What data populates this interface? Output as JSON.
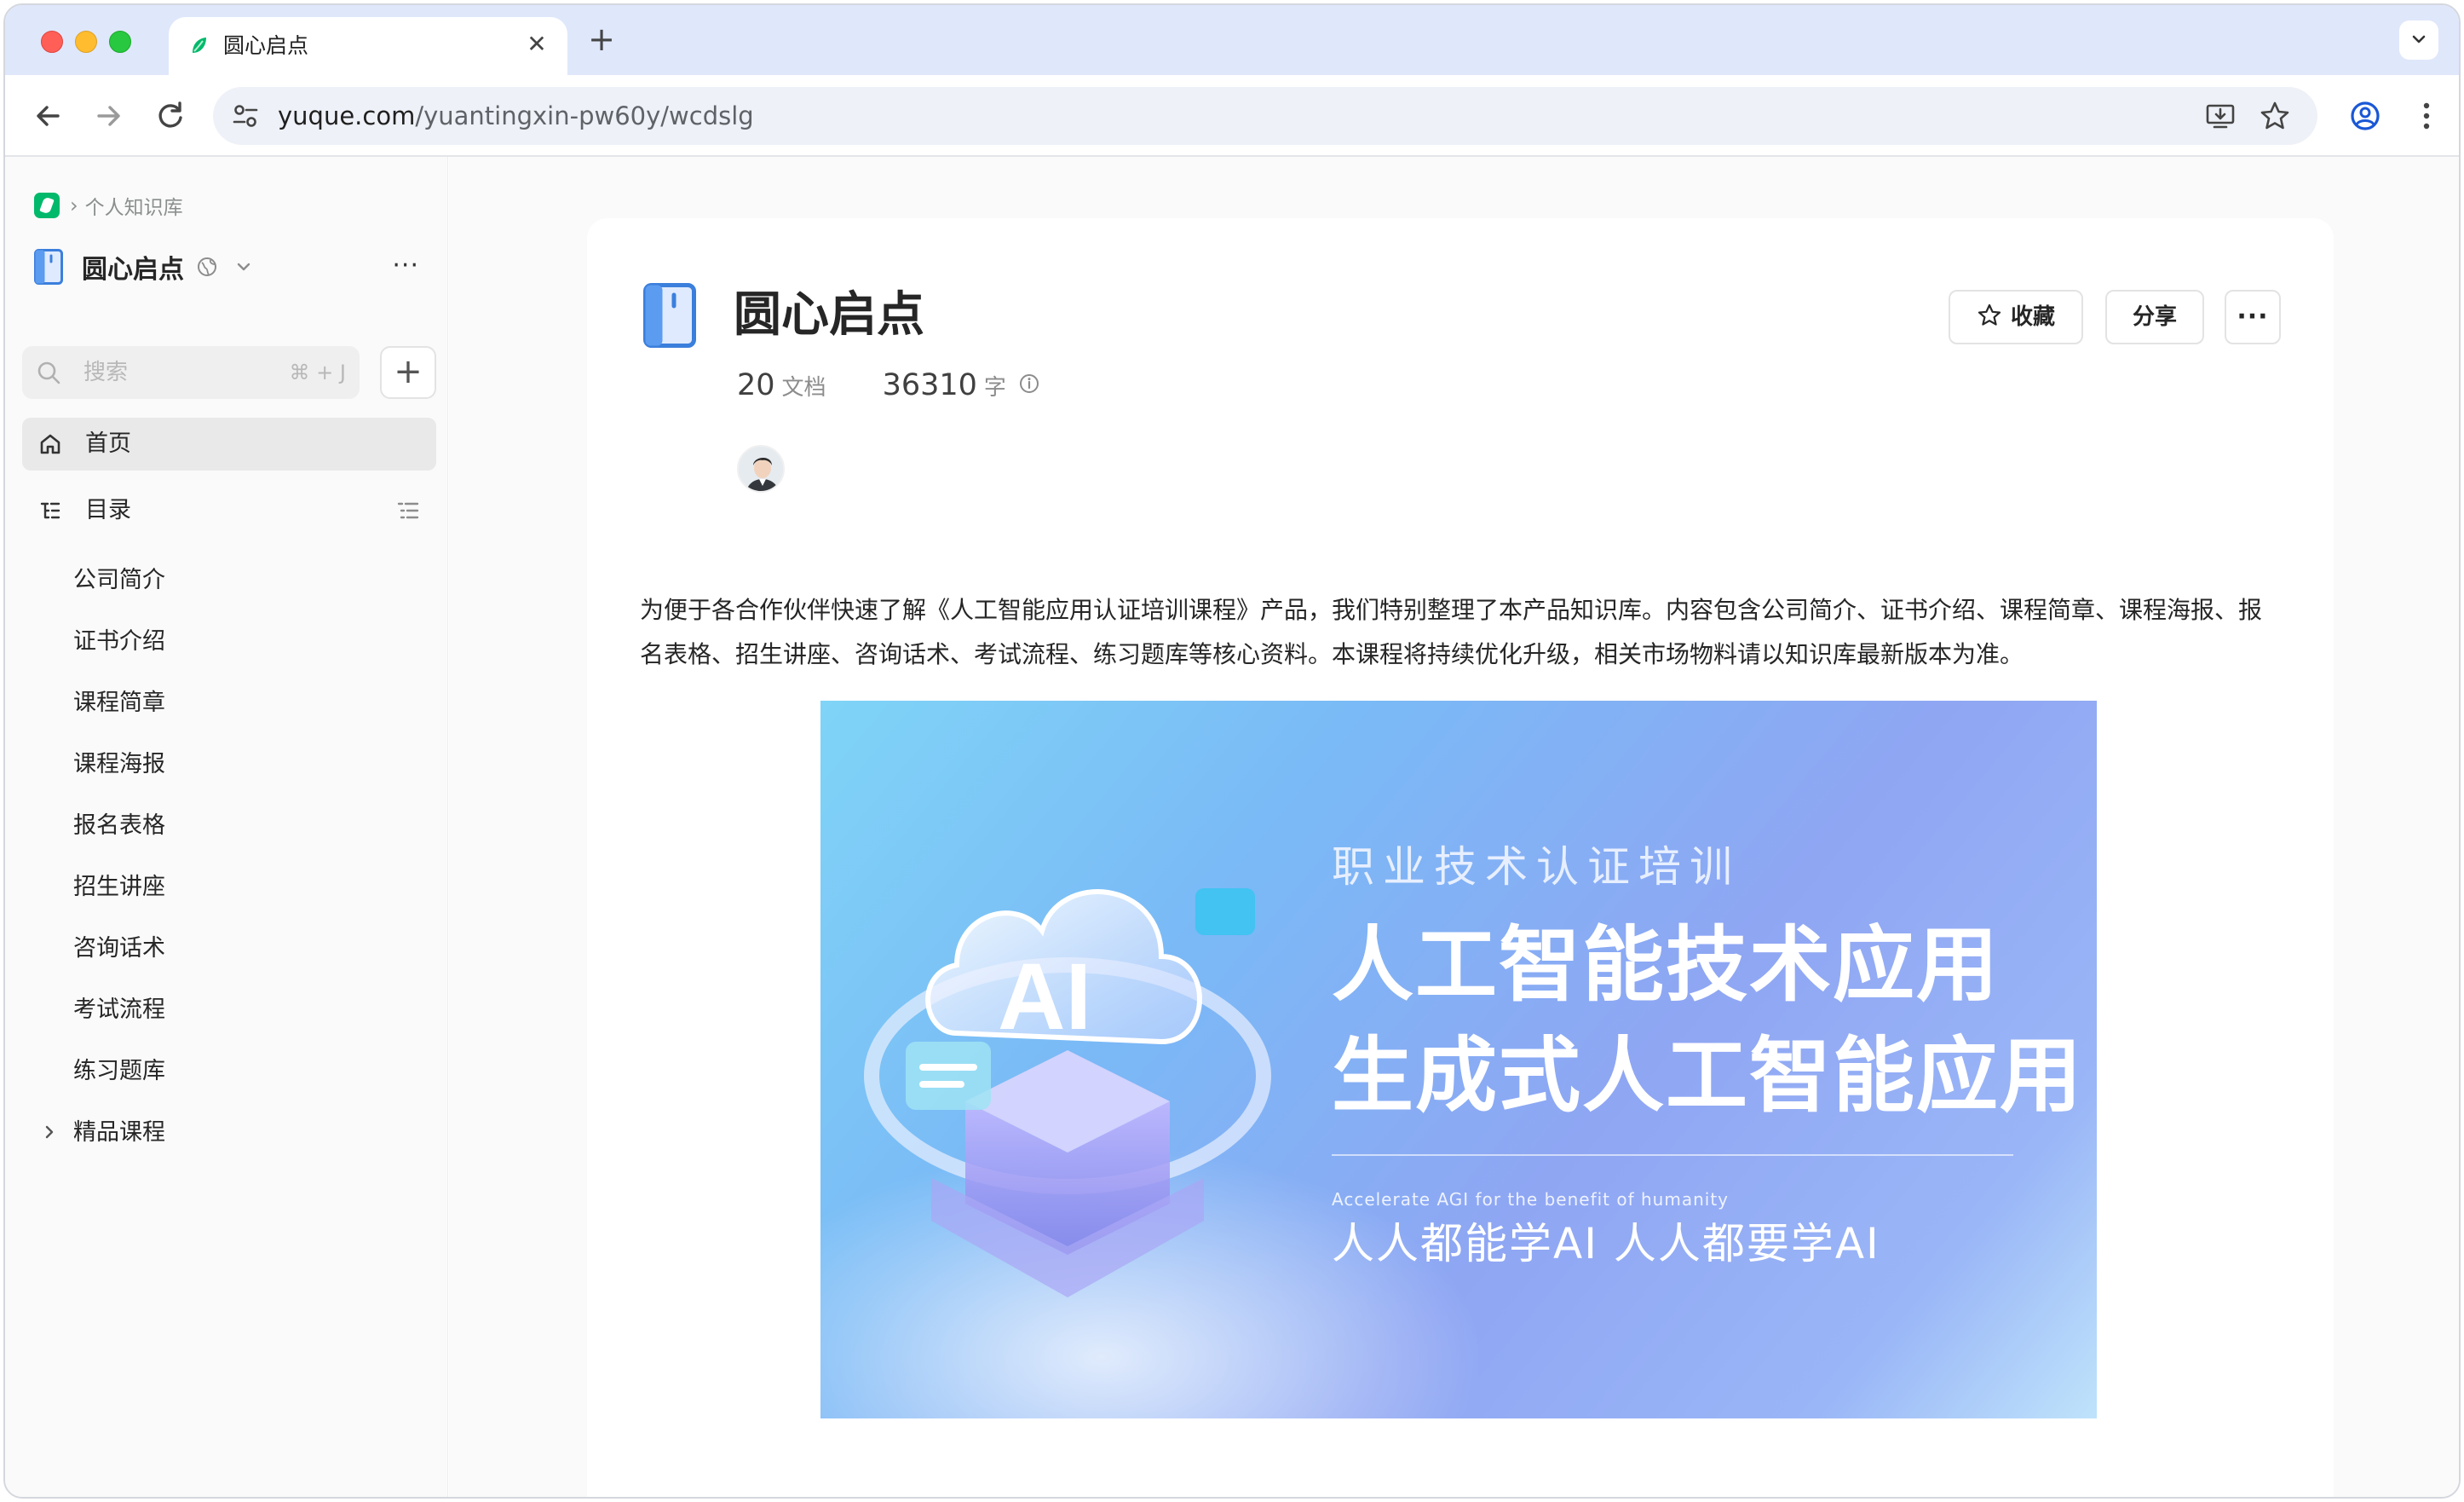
{
  "browser": {
    "tab_title": "圆心启点",
    "url_host": "yuque.com",
    "url_path": "/yuantingxin-pw60y/wcdslg"
  },
  "sidebar": {
    "breadcrumb": "个人知识库",
    "book_title": "圆心启点",
    "more_glyph": "···",
    "search_placeholder": "搜索",
    "search_shortcut": "⌘ + J",
    "add_glyph": "+",
    "home_label": "首页",
    "toc_label": "目录",
    "toc_items": [
      {
        "label": "公司简介"
      },
      {
        "label": "证书介绍"
      },
      {
        "label": "课程简章"
      },
      {
        "label": "课程海报"
      },
      {
        "label": "报名表格"
      },
      {
        "label": "招生讲座"
      },
      {
        "label": "咨询话术"
      },
      {
        "label": "考试流程"
      },
      {
        "label": "练习题库"
      },
      {
        "label": "精品课程",
        "expandable": true
      }
    ]
  },
  "doc": {
    "title": "圆心启点",
    "favorite_label": "收藏",
    "share_label": "分享",
    "more_glyph": "···",
    "doc_count": "20",
    "doc_unit": "文档",
    "word_count": "36310",
    "word_unit": "字",
    "description": "为便于各合作伙伴快速了解《人工智能应用认证培训课程》产品，我们特别整理了本产品知识库。内容包含公司简介、证书介绍、课程简章、课程海报、报名表格、招生讲座、咨询话术、考试流程、练习题库等核心资料。本课程将持续优化升级，相关市场物料请以知识库最新版本为准。",
    "banner": {
      "subtitle": "职业技术认证培训",
      "line1": "人工智能技术应用",
      "line2": "生成式人工智能应用",
      "english": "Accelerate AGI for the benefit of humanity",
      "slogan": "人人都能学AI  人人都要学AI",
      "art_text": "AI"
    }
  },
  "colors": {
    "brand_green": "#00b96b",
    "book_blue": "#3b7fdc",
    "titlebar": "#dfe7fb"
  }
}
